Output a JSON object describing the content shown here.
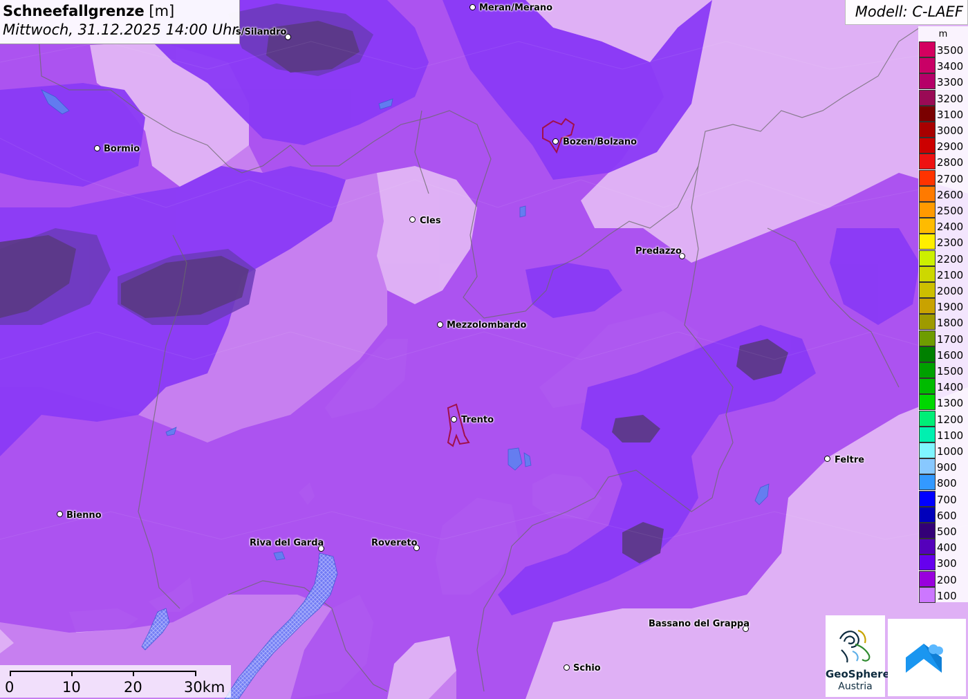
{
  "header": {
    "title": "Schneefallgrenze",
    "unit": "[m]",
    "datetime": "Mittwoch, 31.12.2025 14:00 Uhr"
  },
  "model": {
    "label": "Modell: C-LAEF"
  },
  "legend": {
    "unit": "m",
    "items": [
      {
        "label": "3500",
        "color": "#d4005f"
      },
      {
        "label": "3400",
        "color": "#c90066"
      },
      {
        "label": "3300",
        "color": "#b50068"
      },
      {
        "label": "3200",
        "color": "#9a0a55"
      },
      {
        "label": "3100",
        "color": "#7a0000"
      },
      {
        "label": "3000",
        "color": "#a80000"
      },
      {
        "label": "2900",
        "color": "#cc0000"
      },
      {
        "label": "2800",
        "color": "#ee1111"
      },
      {
        "label": "2700",
        "color": "#ff3300"
      },
      {
        "label": "2600",
        "color": "#ff7a00"
      },
      {
        "label": "2500",
        "color": "#ff9a00"
      },
      {
        "label": "2400",
        "color": "#ffbb00"
      },
      {
        "label": "2300",
        "color": "#ffee00"
      },
      {
        "label": "2200",
        "color": "#ccf000"
      },
      {
        "label": "2100",
        "color": "#cdd800"
      },
      {
        "label": "2000",
        "color": "#cdbf00"
      },
      {
        "label": "1900",
        "color": "#c9a200"
      },
      {
        "label": "1800",
        "color": "#9e9a00"
      },
      {
        "label": "1700",
        "color": "#6e9c00"
      },
      {
        "label": "1600",
        "color": "#008000"
      },
      {
        "label": "1500",
        "color": "#00a000"
      },
      {
        "label": "1400",
        "color": "#00bb00"
      },
      {
        "label": "1300",
        "color": "#00d800"
      },
      {
        "label": "1200",
        "color": "#00ee77"
      },
      {
        "label": "1100",
        "color": "#00f0b0"
      },
      {
        "label": "1000",
        "color": "#7ff5ff"
      },
      {
        "label": "900",
        "color": "#88c8ff"
      },
      {
        "label": "800",
        "color": "#3399ff"
      },
      {
        "label": "700",
        "color": "#0000ff"
      },
      {
        "label": "600",
        "color": "#0000bb"
      },
      {
        "label": "500",
        "color": "#330077"
      },
      {
        "label": "400",
        "color": "#5500bb"
      },
      {
        "label": "300",
        "color": "#6600ee"
      },
      {
        "label": "200",
        "color": "#9900dd"
      },
      {
        "label": "100",
        "color": "#cc77ff"
      }
    ]
  },
  "cities": [
    {
      "name": "Meran/Merano"
    },
    {
      "name": "s/Silandro"
    },
    {
      "name": "Bormio"
    },
    {
      "name": "Bozen/Bolzano"
    },
    {
      "name": "Cles"
    },
    {
      "name": "Predazzo"
    },
    {
      "name": "Mezzolombardo"
    },
    {
      "name": "Trento"
    },
    {
      "name": "Feltre"
    },
    {
      "name": "Bienno"
    },
    {
      "name": "Riva del Garda"
    },
    {
      "name": "Rovereto"
    },
    {
      "name": "Bassano del Grappa"
    },
    {
      "name": "Schio"
    }
  ],
  "scalebar": {
    "labels": [
      "0",
      "10",
      "20",
      "30km"
    ]
  },
  "logos": {
    "geosphere_name": "GeoSphere",
    "geosphere_sub": "Austria"
  },
  "colors": {
    "band_100": "#c77ff0",
    "band_200": "#a94ff0",
    "band_300": "#8a3af6",
    "band_400": "#7a37c8",
    "band_500": "#5f3a92",
    "light_area": "#e3b8f6",
    "lake": "#5e82f0"
  }
}
